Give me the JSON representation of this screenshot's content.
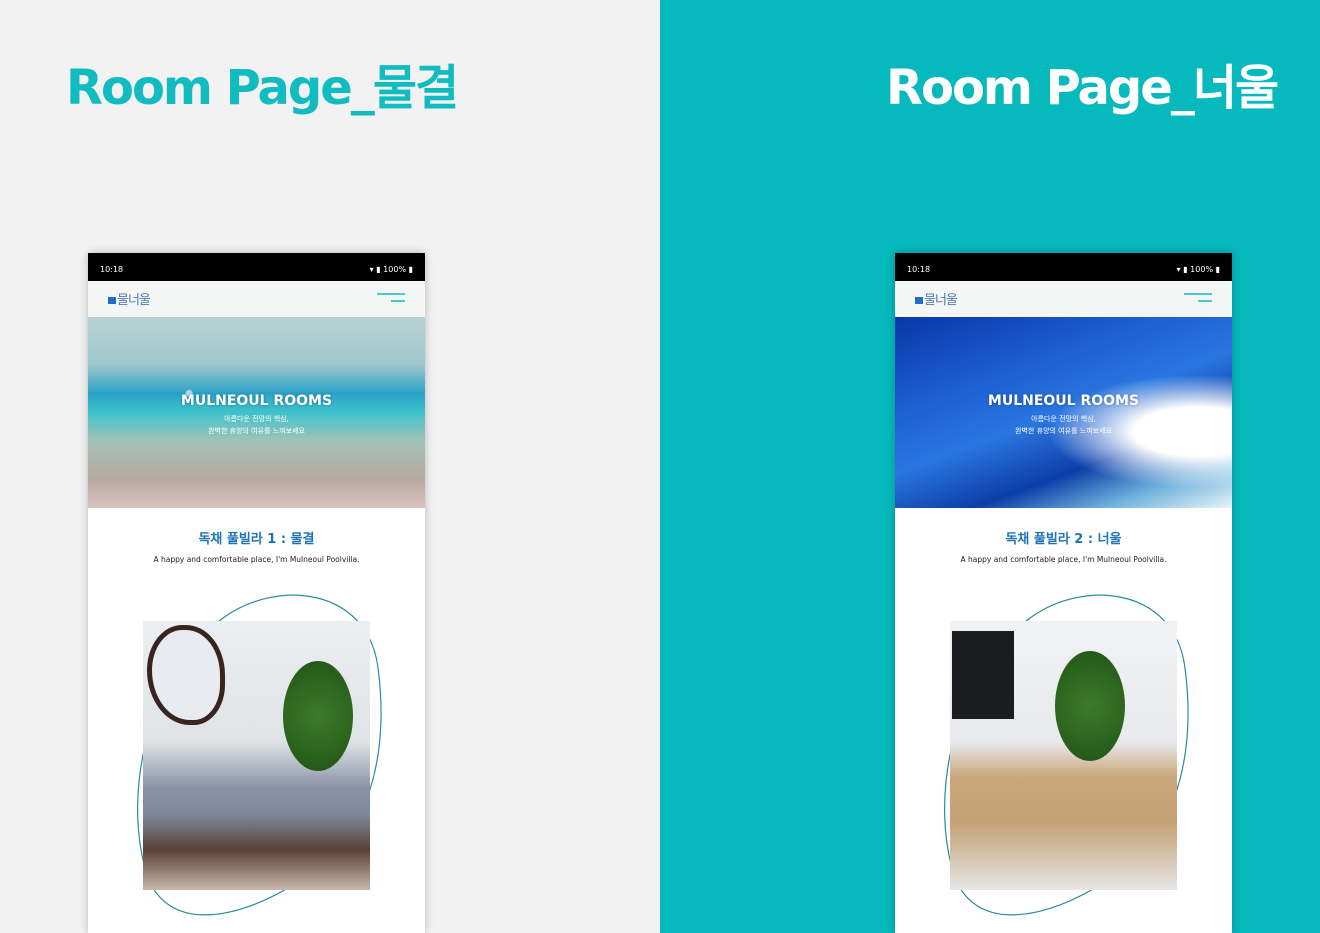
{
  "panels": [
    {
      "title": "Room Page_물결",
      "phone": {
        "time": "10:18",
        "status": "100%",
        "logo": "물너울",
        "hero_title": "MULNEOUL ROOMS",
        "hero_line1": "아름다운 전망의 핵심,",
        "hero_line2": "완벽한 휴양의 여유를 느껴보세요",
        "room_title": "독채 풀빌라 1 : 물결",
        "room_sub": "A happy and comfortable place, I'm Mulneoul Poolvilla."
      }
    },
    {
      "title": "Room Page_너울",
      "phone": {
        "time": "10:18",
        "status": "100%",
        "logo": "물너울",
        "hero_title": "MULNEOUL ROOMS",
        "hero_line1": "아름다운 전망의 핵심,",
        "hero_line2": "완벽한 휴양의 여유를 느껴보세요",
        "room_title": "독채 풀빌라 2 : 너울",
        "room_sub": "A happy and comfortable place, I'm Mulneoul Poolvilla."
      }
    }
  ],
  "colors": {
    "accent": "#05b9bd",
    "room_title": "#1c74b8"
  }
}
